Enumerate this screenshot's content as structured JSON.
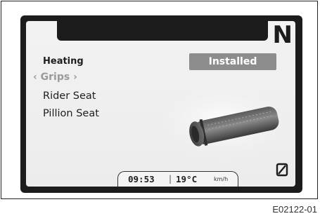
{
  "display": {
    "gear": "N",
    "menu_title": "Heating",
    "selected_item": "‹ Grips ›",
    "items": [
      "Rider Seat",
      "Pillion Seat"
    ],
    "status_badge": "Installed",
    "clock": "09:53",
    "separator": "|",
    "temperature": "19°C",
    "speed_unit": "km/h"
  },
  "figure_ref": "E02122-01",
  "icons": {
    "grip": "heated-grip-icon",
    "speed_reset": "slashed-zero-icon"
  }
}
